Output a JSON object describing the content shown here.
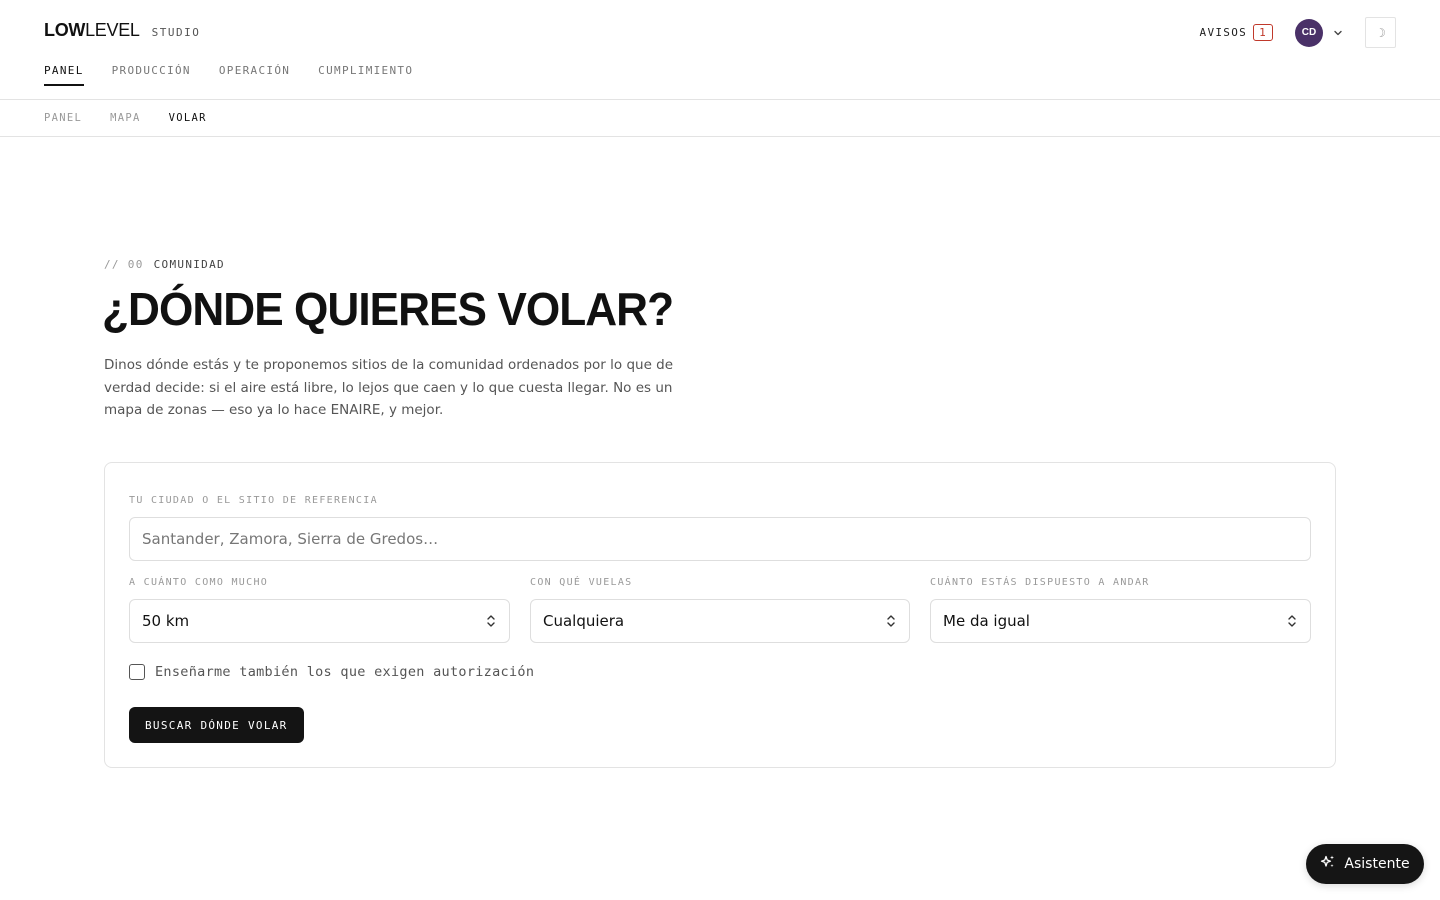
{
  "brand": {
    "low": "LOW",
    "level": "LEVEL",
    "studio": "STUDIO"
  },
  "main_nav": [
    {
      "label": "PANEL",
      "active": true
    },
    {
      "label": "PRODUCCIÓN",
      "active": false
    },
    {
      "label": "OPERACIÓN",
      "active": false
    },
    {
      "label": "CUMPLIMIENTO",
      "active": false
    }
  ],
  "header": {
    "avisos_label": "AVISOS",
    "avisos_count": "1",
    "avatar_initials": "CD",
    "theme_icon": "moon-icon"
  },
  "sub_nav": [
    {
      "label": "PANEL",
      "active": false
    },
    {
      "label": "MAPA",
      "active": false
    },
    {
      "label": "VOLAR",
      "active": true
    }
  ],
  "hero": {
    "eyebrow_num": "// 00",
    "eyebrow_label": "COMUNIDAD",
    "title": "¿DÓNDE QUIERES VOLAR?",
    "intro": "Dinos dónde estás y te proponemos sitios de la comunidad ordenados por lo que de verdad decide: si el aire está libre, lo lejos que caen y lo que cuesta llegar. No es un mapa de zonas — eso ya lo hace ENAIRE, y mejor."
  },
  "form": {
    "city_label": "TU CIUDAD O EL SITIO DE REFERENCIA",
    "city_placeholder": "Santander, Zamora, Sierra de Gredos…",
    "city_value": "",
    "distance_label": "A CUÁNTO COMO MUCHO",
    "distance_value": "50 km",
    "aircraft_label": "CON QUÉ VUELAS",
    "aircraft_value": "Cualquiera",
    "walk_label": "CUÁNTO ESTÁS DISPUESTO A ANDAR",
    "walk_value": "Me da igual",
    "auth_checkbox_label": "Enseñarme también los que exigen autorización",
    "auth_checked": false,
    "submit_label": "BUSCAR DÓNDE VOLAR"
  },
  "assistant": {
    "label": "Asistente",
    "icon": "sparkles-icon"
  },
  "colors": {
    "accent_dark": "#141414",
    "avatar_bg": "#4a3168",
    "badge_red": "#c0392b",
    "border": "#e3e3e3"
  }
}
